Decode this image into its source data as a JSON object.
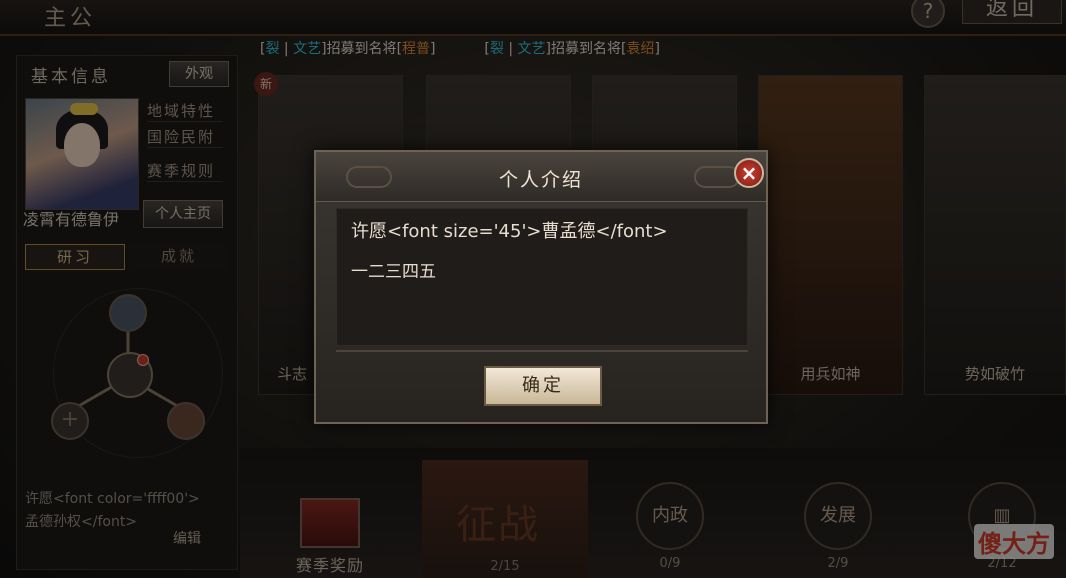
{
  "header": {
    "title": "主公",
    "help_label": "?",
    "back_label": "返回"
  },
  "ticker": [
    {
      "tag_a": "裂",
      "tag_sep": " | ",
      "tag_b": "文艺",
      "text": "招募到名将",
      "hero": "程普"
    },
    {
      "tag_a": "裂",
      "tag_sep": " | ",
      "tag_b": "文艺",
      "text": "招募到名将",
      "hero": "袁绍"
    }
  ],
  "left_panel": {
    "title": "基本信息",
    "appearance_btn": "外观",
    "player_name": "凌霄有德鲁伊",
    "links": [
      "地域特性",
      "国险民附",
      "赛季规则"
    ],
    "homepage_btn": "个人主页",
    "tabs": [
      "研习",
      "成就"
    ],
    "signature": "许愿<font color='ffff00'>孟德孙权</font>",
    "edit_label": "编辑"
  },
  "cards": {
    "new_badge": "新",
    "items": [
      {
        "label": "斗志",
        "badge": ""
      },
      {
        "label": "",
        "badge": ""
      },
      {
        "label": "",
        "badge": ""
      },
      {
        "label": "用兵如神",
        "badge": ""
      },
      {
        "label": "势如破竹",
        "badge": ""
      }
    ]
  },
  "dialog": {
    "title": "个人介绍",
    "close_label": "×",
    "line1": "许愿<font size='45'>曹孟德</font>",
    "line2": "一二三四五",
    "confirm_label": "确定"
  },
  "bottom_bar": {
    "reward_label": "赛季奖励",
    "zhengzhan_label": "征战",
    "zhengzhan_count": "2/15",
    "neizheng_label": "内政",
    "neizheng_count": "0/9",
    "fazhan_label": "发展",
    "fazhan_count": "2/9",
    "fourth_count": "2/12"
  },
  "watermark": "傻大方"
}
